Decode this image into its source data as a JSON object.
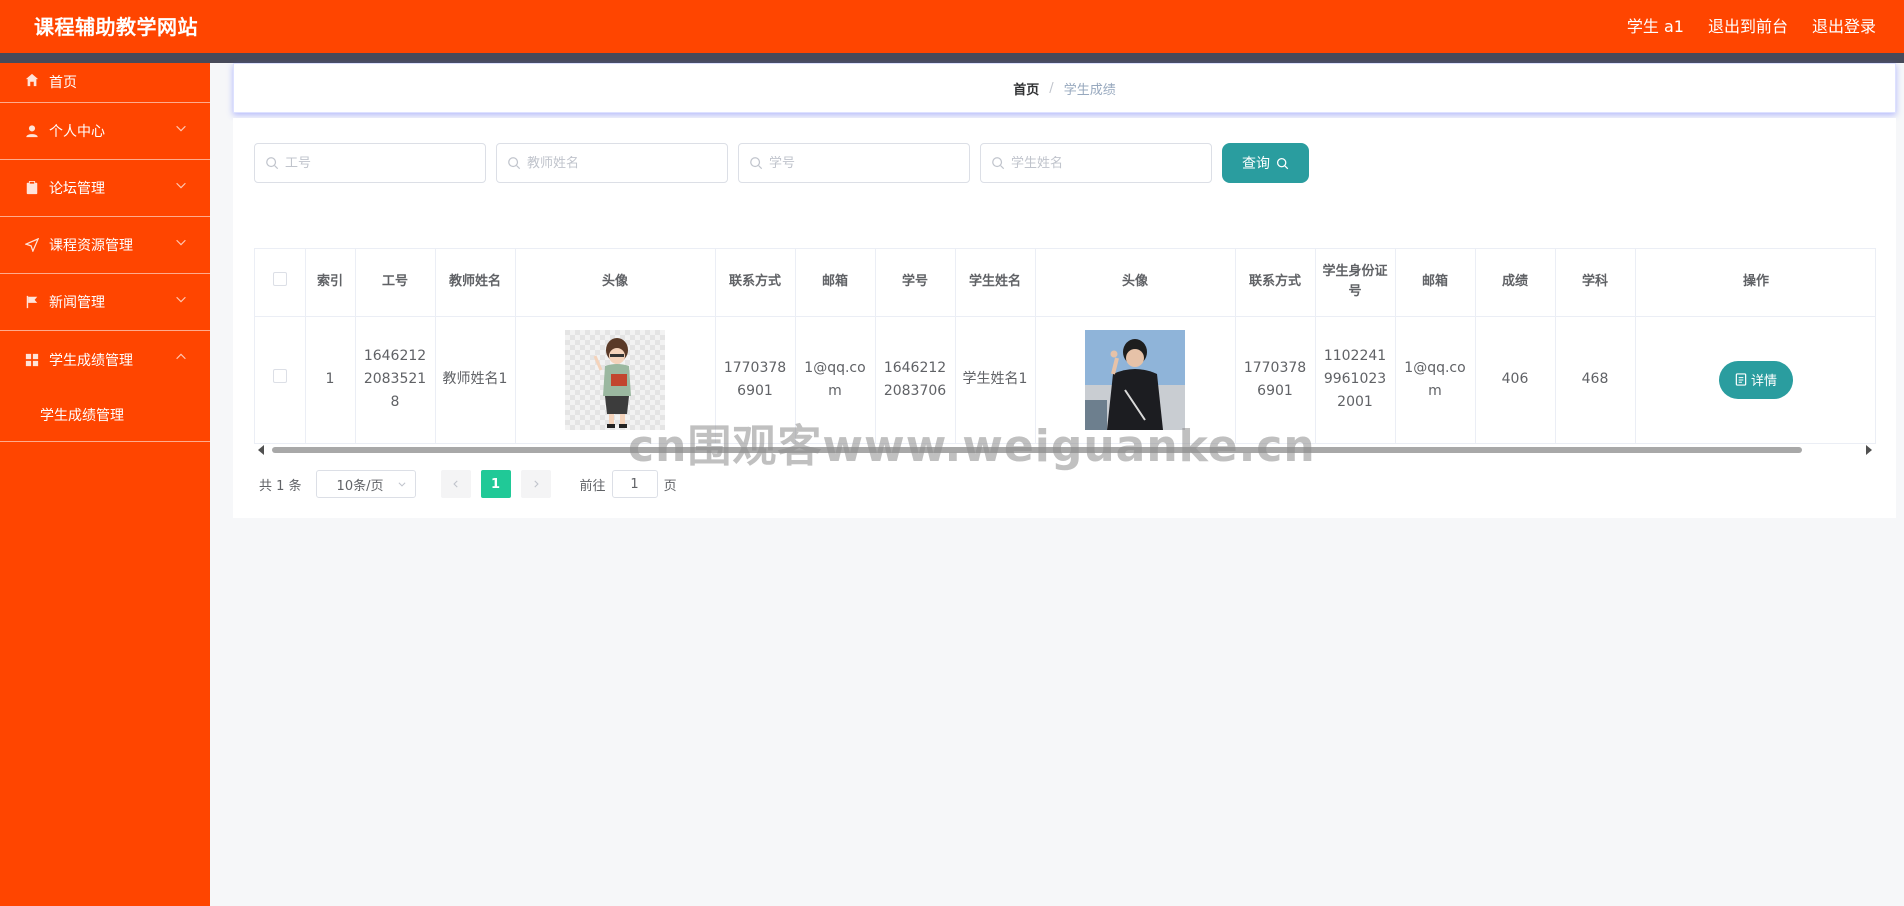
{
  "header": {
    "title": "课程辅助教学网站",
    "user": "学生 a1",
    "to_front": "退出到前台",
    "logout": "退出登录"
  },
  "colors": {
    "brand": "#ff4500",
    "accent": "#2a9d9f",
    "page_active": "#20c997",
    "stripe": "#474a59"
  },
  "sidebar": {
    "items": [
      {
        "label": "首页",
        "icon": "home-icon"
      },
      {
        "label": "个人中心",
        "icon": "user-icon"
      },
      {
        "label": "论坛管理",
        "icon": "clipboard-icon"
      },
      {
        "label": "课程资源管理",
        "icon": "paper-plane-icon"
      },
      {
        "label": "新闻管理",
        "icon": "flag-icon"
      },
      {
        "label": "学生成绩管理",
        "icon": "grid-icon"
      }
    ],
    "submenu_label": "学生成绩管理"
  },
  "breadcrumb": {
    "home": "首页",
    "separator": "/",
    "current": "学生成绩"
  },
  "search": {
    "teacher_no_placeholder": "工号",
    "teacher_name_placeholder": "教师姓名",
    "student_no_placeholder": "学号",
    "student_name_placeholder": "学生姓名",
    "query_label": "查询"
  },
  "table": {
    "headers": [
      "索引",
      "工号",
      "教师姓名",
      "头像",
      "联系方式",
      "邮箱",
      "学号",
      "学生姓名",
      "头像",
      "联系方式",
      "学生身份证号",
      "邮箱",
      "成绩",
      "学科",
      "操作"
    ],
    "rows": [
      {
        "index": "1",
        "teacher_no": "16462122083521 8",
        "teacher_name": "教师姓名1",
        "teacher_phone": "17703786901",
        "teacher_email": "1@qq.com",
        "student_no": "16462122083706",
        "student_name": "学生姓名1",
        "student_phone": "17703786901",
        "student_id_card": "110224199610232001",
        "student_email": "1@qq.com",
        "score": "406",
        "subject": "468",
        "detail_label": "详情"
      }
    ]
  },
  "pagination": {
    "total": "共 1 条",
    "page_size": "10条/页",
    "current_page": "1",
    "goto_prefix": "前往",
    "goto_value": "1",
    "goto_suffix": "页"
  },
  "watermark": "cn围观客www.weiguanke.cn"
}
